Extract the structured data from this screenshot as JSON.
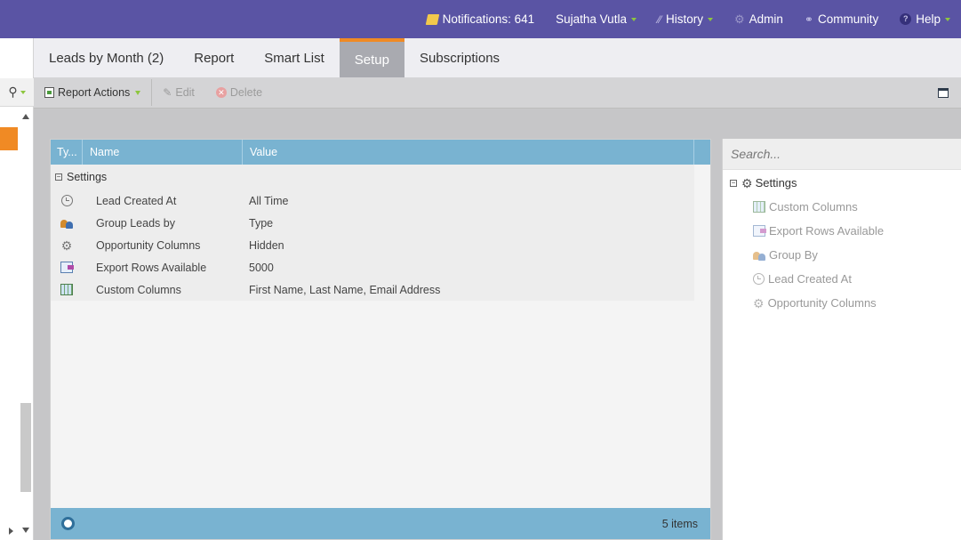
{
  "topnav": {
    "notifications": "Notifications: 641",
    "user": "Sujatha Vutla",
    "history": "History",
    "admin": "Admin",
    "community": "Community",
    "help": "Help",
    "help_glyph": "?"
  },
  "tabs": [
    {
      "label": "Leads by Month (2)",
      "active": false
    },
    {
      "label": "Report",
      "active": false
    },
    {
      "label": "Smart List",
      "active": false
    },
    {
      "label": "Setup",
      "active": true
    },
    {
      "label": "Subscriptions",
      "active": false
    }
  ],
  "toolbar": {
    "report_actions": "Report Actions",
    "edit": "Edit",
    "delete": "Delete"
  },
  "grid": {
    "columns": [
      "Ty...",
      "Name",
      "Value"
    ],
    "group": "Settings",
    "rows": [
      {
        "icon": "clock-icon",
        "name": "Lead Created At",
        "value": "All Time"
      },
      {
        "icon": "group-leads-icon",
        "name": "Group Leads by",
        "value": "Type"
      },
      {
        "icon": "gear-icon",
        "name": "Opportunity Columns",
        "value": "Hidden"
      },
      {
        "icon": "export-rows-icon",
        "name": "Export Rows Available",
        "value": "5000"
      },
      {
        "icon": "custom-columns-icon",
        "name": "Custom Columns",
        "value": "First Name, Last Name, Email Address"
      }
    ],
    "footer_count": "5 items"
  },
  "rpanel": {
    "search_placeholder": "Search...",
    "tree_root": "Settings",
    "tree_items": [
      {
        "icon": "custom-columns-icon",
        "label": "Custom Columns"
      },
      {
        "icon": "export-rows-icon",
        "label": "Export Rows Available"
      },
      {
        "icon": "group-leads-icon",
        "label": "Group By"
      },
      {
        "icon": "clock-icon",
        "label": "Lead Created At"
      },
      {
        "icon": "gear-icon",
        "label": "Opportunity Columns"
      }
    ]
  },
  "colors": {
    "topbar": "#5a54a4",
    "accent_orange": "#f08a24",
    "grid_header": "#79b3d1",
    "caret_green": "#8dc63f"
  }
}
